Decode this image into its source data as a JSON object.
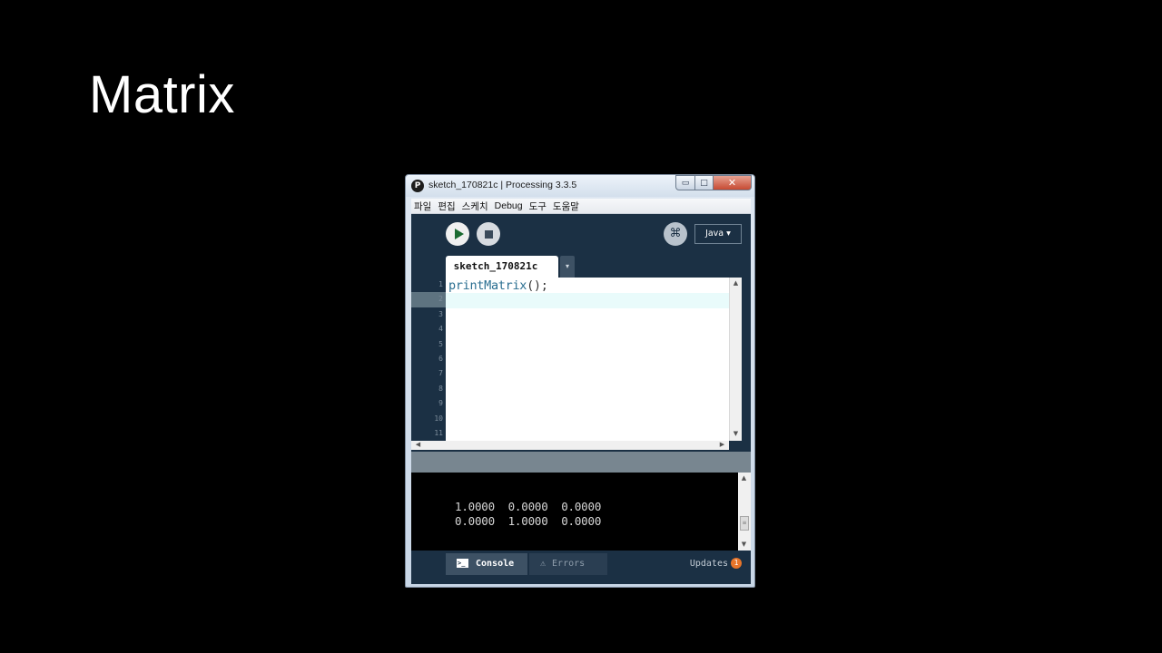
{
  "slide": {
    "title": "Matrix"
  },
  "window": {
    "title": "sketch_170821c | Processing 3.3.5",
    "app_icon": "P",
    "controls": {
      "minimize": "▭",
      "maximize": "□",
      "close": "✕"
    }
  },
  "menu": [
    "파일",
    "편집",
    "스케치",
    "Debug",
    "도구",
    "도움말"
  ],
  "toolbar": {
    "mode": "Java ▾",
    "debug_icon": "⌘"
  },
  "tab": {
    "name": "sketch_170821c",
    "arrow": "▾"
  },
  "editor": {
    "line_numbers": [
      "1",
      "2",
      "3",
      "4",
      "5",
      "6",
      "7",
      "8",
      "9",
      "10",
      "11"
    ],
    "code_fn": "printMatrix",
    "code_rest": "();",
    "current_line": 2
  },
  "scroll": {
    "up": "▲",
    "down": "▼",
    "left": "◀",
    "right": "▶",
    "thumb": "≡"
  },
  "console": {
    "lines": [
      "1.0000  0.0000  0.0000",
      "0.0000  1.0000  0.0000"
    ]
  },
  "footer": {
    "console_label": "Console",
    "errors_label": "Errors",
    "updates_label": "Updates",
    "updates_count": "1",
    "term_icon": ">_",
    "warning_icon": "⚠"
  },
  "colors": {
    "ide_bg": "#1b3044",
    "code_fn": "#2b6f91",
    "badge": "#e8752a"
  }
}
